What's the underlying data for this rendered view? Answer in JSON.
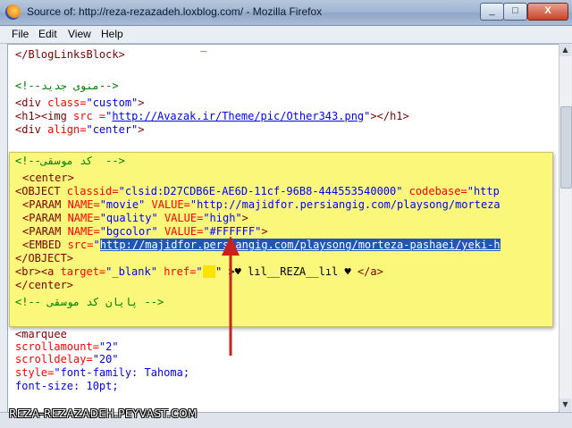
{
  "window": {
    "title": "Source of: http://reza-rezazadeh.loxblog.com/ - Mozilla Firefox",
    "buttons": {
      "minimize": "_",
      "maximize": "□",
      "close": "X"
    }
  },
  "menu": [
    "File",
    "Edit",
    "View",
    "Help"
  ],
  "source_lines": {
    "l0": "\"_",
    "l1_tag": "</BlogLinksBlock>",
    "l2_comment": "<!--منوی جدید-->",
    "l3_open": "<div ",
    "l3_attr": "class=",
    "l3_val": "\"custom\"",
    "l3_close": ">",
    "l4_open": "<h1><img ",
    "l4_attr": "src =",
    "l4_q1": "\"",
    "l4_link": "http://Avazak.ir/Theme/pic/Other343.png",
    "l4_q2": "\"",
    "l4_close": "></h1>",
    "l5_open": "<div ",
    "l5_attr": "align=",
    "l5_val": "\"center\"",
    "l5_close": ">",
    "m1": "<marquee",
    "m2_attr": "scrollamount=",
    "m2_val": "\"2\"",
    "m3_attr": "scrolldelay=",
    "m3_val": "\"20\"",
    "m4_attr": "style=",
    "m4_val": "\"font-family: Tahoma;",
    "m5_val": "font-size: 10pt;"
  },
  "overlay_lines": {
    "c1": "<!--کد موسقی  -->",
    "c2": "<center>",
    "c3_tag": "<OBJECT ",
    "c3_attr": "classid=",
    "c3_val": "\"clsid:D27CDB6E-AE6D-11cf-96B8-444553540000\" ",
    "c3_attr2": "codebase=",
    "c3_val2": "\"http",
    "p1_tag": "<PARAM ",
    "p1_attr": "NAME=",
    "p1_val": "\"movie\" ",
    "p1_attr2": "VALUE=",
    "p1_val2": "\"http://majidfor.persiangig.com/playsong/morteza",
    "p2_tag": "<PARAM ",
    "p2_attr": "NAME=",
    "p2_val": "\"quality\" ",
    "p2_attr2": "VALUE=",
    "p2_val2": "\"high\"",
    "p2_close": ">",
    "p3_tag": "<PARAM ",
    "p3_attr": "NAME=",
    "p3_val": "\"bgcolor\" ",
    "p3_attr2": "VALUE=",
    "p3_val2": "\"#FFFFFF\"",
    "p3_close": ">",
    "e_tag": "<EMBED ",
    "e_attr": "src=",
    "e_q": "\"",
    "e_link": "http://majidfor.persiangig.com/playsong/morteza-pashaei/yeki-h",
    "c_object_close": "</OBJECT>",
    "br_tag": "<br><a ",
    "br_attr": "target=",
    "br_val": "\"_blank\" ",
    "br_attr2": "href=",
    "br_val2": "\"",
    "br_text": "\" >♥ lıl__REZA__lıl ♥ ",
    "br_close": "</a>",
    "center_close": "</center>",
    "c_end": "<!-- پایان کد موسقی -->"
  },
  "watermark": "REZA-REZAZADEH.PEYVAST.COM",
  "colors": {
    "tag": "#800000",
    "attr": "#ff0000",
    "value": "#0000ff",
    "comment": "#008000",
    "highlight": "#faf77b",
    "selection": "#1f56b8",
    "arrow": "#cc1f1f"
  }
}
